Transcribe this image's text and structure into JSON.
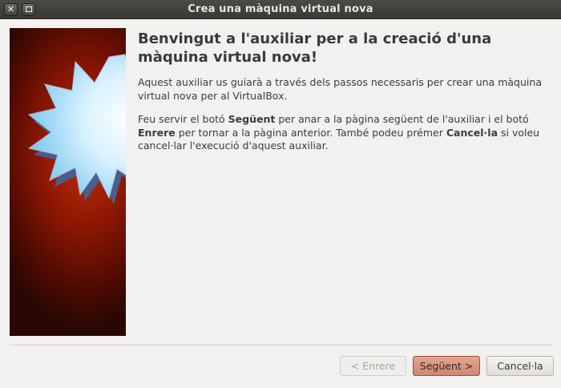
{
  "window": {
    "title": "Crea una màquina virtual nova",
    "close_glyph": "✕"
  },
  "content": {
    "heading": "Benvingut a l'auxiliar per a la creació d'una màquina virtual nova!",
    "para1": "Aquest auxiliar us guiarà a través dels passos necessaris per crear una màquina virtual nova per al VirtualBox.",
    "para2": {
      "t1": "Feu servir el botó ",
      "b1": "Següent",
      "t2": " per anar a la pàgina següent de l'auxiliar i el botó ",
      "b2": "Enrere",
      "t3": " per tornar a la pàgina anterior. També podeu prémer ",
      "b3": "Cancel·la",
      "t4": " si voleu cancel·lar l'execució d'aquest auxiliar."
    }
  },
  "buttons": {
    "back": "< Enrere",
    "next": "Següent >",
    "cancel": "Cancel·la"
  },
  "colors": {
    "banner_dark": "#4a0a02",
    "banner_red": "#c62f07",
    "star_face": "#e7f7ff",
    "next_button": "#d89780"
  },
  "icons": {
    "banner_image": "virtualbox-star-icon"
  }
}
